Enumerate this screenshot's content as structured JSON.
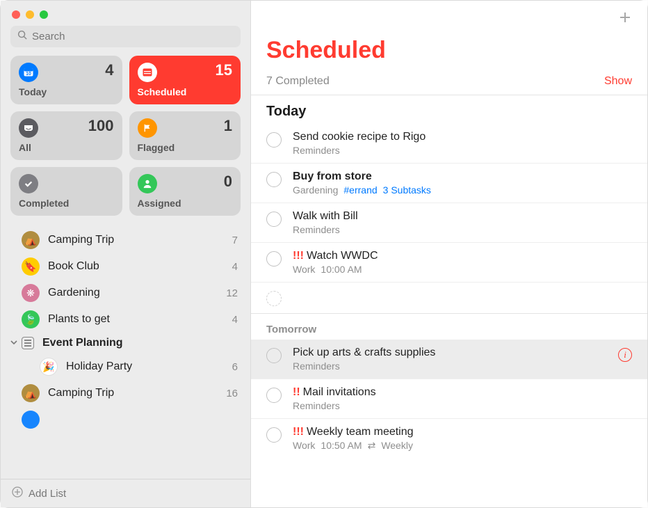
{
  "search": {
    "placeholder": "Search"
  },
  "smartLists": {
    "today": {
      "label": "Today",
      "count": 4,
      "icon_bg": "#007aff"
    },
    "scheduled": {
      "label": "Scheduled",
      "count": 15,
      "icon_bg": "#ff3b30",
      "active": true
    },
    "all": {
      "label": "All",
      "count": 100,
      "icon_bg": "#5b5b60"
    },
    "flagged": {
      "label": "Flagged",
      "count": 1,
      "icon_bg": "#ff9500"
    },
    "completed": {
      "label": "Completed",
      "count": "",
      "icon_bg": "#7e7e83"
    },
    "assigned": {
      "label": "Assigned",
      "count": 0,
      "icon_bg": "#34c759"
    }
  },
  "sidebarLists": [
    {
      "name": "Camping Trip",
      "count": 7,
      "color": "#b08d3f",
      "emoji": "⛺"
    },
    {
      "name": "Book Club",
      "count": 4,
      "color": "#ffcc00",
      "emoji": "🔖"
    },
    {
      "name": "Gardening",
      "count": 12,
      "color": "#d77a9a",
      "emoji": "❋"
    },
    {
      "name": "Plants to get",
      "count": 4,
      "color": "#34c759",
      "emoji": "🍃"
    }
  ],
  "group": {
    "name": "Event Planning",
    "children": [
      {
        "name": "Holiday Party",
        "count": 6
      },
      {
        "name": "Camping Trip",
        "count": 16,
        "color": "#b08d3f",
        "emoji": "⛺"
      }
    ]
  },
  "addListLabel": "Add List",
  "main": {
    "title": "Scheduled",
    "completedSummary": "7 Completed",
    "showLabel": "Show",
    "sections": [
      {
        "header": "Today",
        "style": "large",
        "items": [
          {
            "title": "Send cookie recipe to Rigo",
            "sub": [
              "Reminders"
            ]
          },
          {
            "title": "Buy from store",
            "bold": true,
            "sub": [
              "Gardening"
            ],
            "tag": "#errand",
            "link": "3 Subtasks"
          },
          {
            "title": "Walk with Bill",
            "sub": [
              "Reminders"
            ]
          },
          {
            "title": "Watch WWDC",
            "priority": "!!!",
            "sub": [
              "Work",
              "10:00 AM"
            ]
          }
        ],
        "ghostRow": true
      },
      {
        "header": "Tomorrow",
        "style": "small",
        "items": [
          {
            "title": "Pick up arts & crafts supplies",
            "sub": [
              "Reminders"
            ],
            "selected": true,
            "info": true
          },
          {
            "title": "Mail invitations",
            "priority": "!!",
            "sub": [
              "Reminders"
            ]
          },
          {
            "title": "Weekly team meeting",
            "priority": "!!!",
            "sub": [
              "Work",
              "10:50 AM"
            ],
            "repeat": "Weekly"
          }
        ]
      }
    ]
  }
}
